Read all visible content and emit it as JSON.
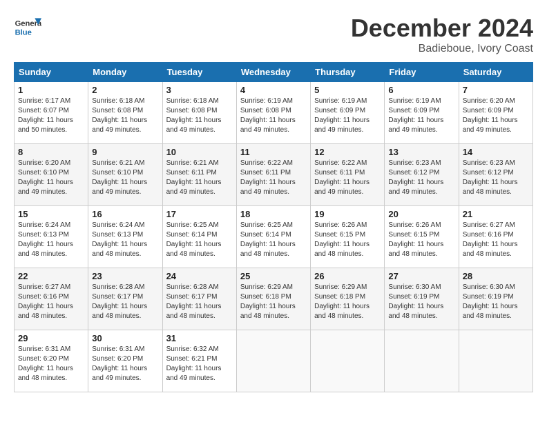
{
  "header": {
    "logo_line1": "General",
    "logo_line2": "Blue",
    "month": "December 2024",
    "location": "Badieboue, Ivory Coast"
  },
  "weekdays": [
    "Sunday",
    "Monday",
    "Tuesday",
    "Wednesday",
    "Thursday",
    "Friday",
    "Saturday"
  ],
  "weeks": [
    [
      {
        "day": "1",
        "sunrise": "6:17 AM",
        "sunset": "6:07 PM",
        "daylight": "11 hours and 50 minutes."
      },
      {
        "day": "2",
        "sunrise": "6:18 AM",
        "sunset": "6:08 PM",
        "daylight": "11 hours and 49 minutes."
      },
      {
        "day": "3",
        "sunrise": "6:18 AM",
        "sunset": "6:08 PM",
        "daylight": "11 hours and 49 minutes."
      },
      {
        "day": "4",
        "sunrise": "6:19 AM",
        "sunset": "6:08 PM",
        "daylight": "11 hours and 49 minutes."
      },
      {
        "day": "5",
        "sunrise": "6:19 AM",
        "sunset": "6:09 PM",
        "daylight": "11 hours and 49 minutes."
      },
      {
        "day": "6",
        "sunrise": "6:19 AM",
        "sunset": "6:09 PM",
        "daylight": "11 hours and 49 minutes."
      },
      {
        "day": "7",
        "sunrise": "6:20 AM",
        "sunset": "6:09 PM",
        "daylight": "11 hours and 49 minutes."
      }
    ],
    [
      {
        "day": "8",
        "sunrise": "6:20 AM",
        "sunset": "6:10 PM",
        "daylight": "11 hours and 49 minutes."
      },
      {
        "day": "9",
        "sunrise": "6:21 AM",
        "sunset": "6:10 PM",
        "daylight": "11 hours and 49 minutes."
      },
      {
        "day": "10",
        "sunrise": "6:21 AM",
        "sunset": "6:11 PM",
        "daylight": "11 hours and 49 minutes."
      },
      {
        "day": "11",
        "sunrise": "6:22 AM",
        "sunset": "6:11 PM",
        "daylight": "11 hours and 49 minutes."
      },
      {
        "day": "12",
        "sunrise": "6:22 AM",
        "sunset": "6:11 PM",
        "daylight": "11 hours and 49 minutes."
      },
      {
        "day": "13",
        "sunrise": "6:23 AM",
        "sunset": "6:12 PM",
        "daylight": "11 hours and 49 minutes."
      },
      {
        "day": "14",
        "sunrise": "6:23 AM",
        "sunset": "6:12 PM",
        "daylight": "11 hours and 48 minutes."
      }
    ],
    [
      {
        "day": "15",
        "sunrise": "6:24 AM",
        "sunset": "6:13 PM",
        "daylight": "11 hours and 48 minutes."
      },
      {
        "day": "16",
        "sunrise": "6:24 AM",
        "sunset": "6:13 PM",
        "daylight": "11 hours and 48 minutes."
      },
      {
        "day": "17",
        "sunrise": "6:25 AM",
        "sunset": "6:14 PM",
        "daylight": "11 hours and 48 minutes."
      },
      {
        "day": "18",
        "sunrise": "6:25 AM",
        "sunset": "6:14 PM",
        "daylight": "11 hours and 48 minutes."
      },
      {
        "day": "19",
        "sunrise": "6:26 AM",
        "sunset": "6:15 PM",
        "daylight": "11 hours and 48 minutes."
      },
      {
        "day": "20",
        "sunrise": "6:26 AM",
        "sunset": "6:15 PM",
        "daylight": "11 hours and 48 minutes."
      },
      {
        "day": "21",
        "sunrise": "6:27 AM",
        "sunset": "6:16 PM",
        "daylight": "11 hours and 48 minutes."
      }
    ],
    [
      {
        "day": "22",
        "sunrise": "6:27 AM",
        "sunset": "6:16 PM",
        "daylight": "11 hours and 48 minutes."
      },
      {
        "day": "23",
        "sunrise": "6:28 AM",
        "sunset": "6:17 PM",
        "daylight": "11 hours and 48 minutes."
      },
      {
        "day": "24",
        "sunrise": "6:28 AM",
        "sunset": "6:17 PM",
        "daylight": "11 hours and 48 minutes."
      },
      {
        "day": "25",
        "sunrise": "6:29 AM",
        "sunset": "6:18 PM",
        "daylight": "11 hours and 48 minutes."
      },
      {
        "day": "26",
        "sunrise": "6:29 AM",
        "sunset": "6:18 PM",
        "daylight": "11 hours and 48 minutes."
      },
      {
        "day": "27",
        "sunrise": "6:30 AM",
        "sunset": "6:19 PM",
        "daylight": "11 hours and 48 minutes."
      },
      {
        "day": "28",
        "sunrise": "6:30 AM",
        "sunset": "6:19 PM",
        "daylight": "11 hours and 48 minutes."
      }
    ],
    [
      {
        "day": "29",
        "sunrise": "6:31 AM",
        "sunset": "6:20 PM",
        "daylight": "11 hours and 48 minutes."
      },
      {
        "day": "30",
        "sunrise": "6:31 AM",
        "sunset": "6:20 PM",
        "daylight": "11 hours and 49 minutes."
      },
      {
        "day": "31",
        "sunrise": "6:32 AM",
        "sunset": "6:21 PM",
        "daylight": "11 hours and 49 minutes."
      },
      null,
      null,
      null,
      null
    ]
  ]
}
